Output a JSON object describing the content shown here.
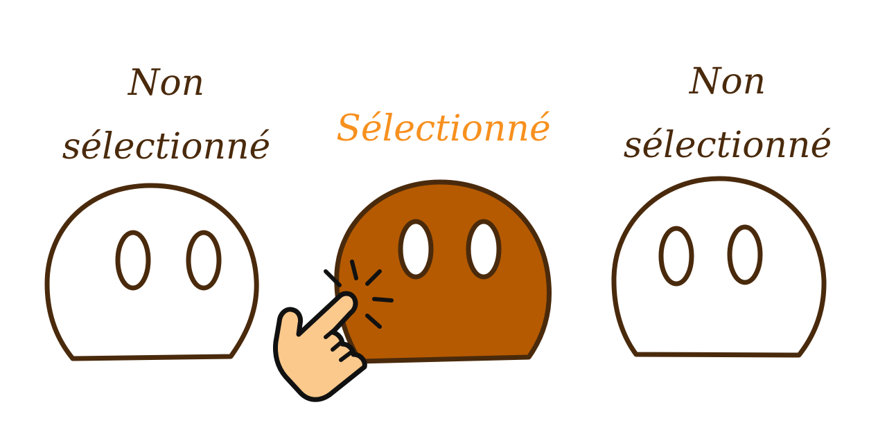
{
  "options": [
    {
      "state": "unselected",
      "label_lines": [
        "Non",
        "sélectionné"
      ],
      "fill": "#ffffff"
    },
    {
      "state": "selected",
      "label_lines": [
        "Sélectionné"
      ],
      "fill": "#b55a00"
    },
    {
      "state": "unselected",
      "label_lines": [
        "Non",
        "sélectionné"
      ],
      "fill": "#ffffff"
    }
  ],
  "colors": {
    "outline": "#4a2a0c",
    "label_unselected": "#4a2a0c",
    "label_selected": "#f7901e",
    "hand_fill": "#fbc98c",
    "hand_outline": "#111111"
  },
  "icons": {
    "pointer": "tapping-hand-icon"
  }
}
